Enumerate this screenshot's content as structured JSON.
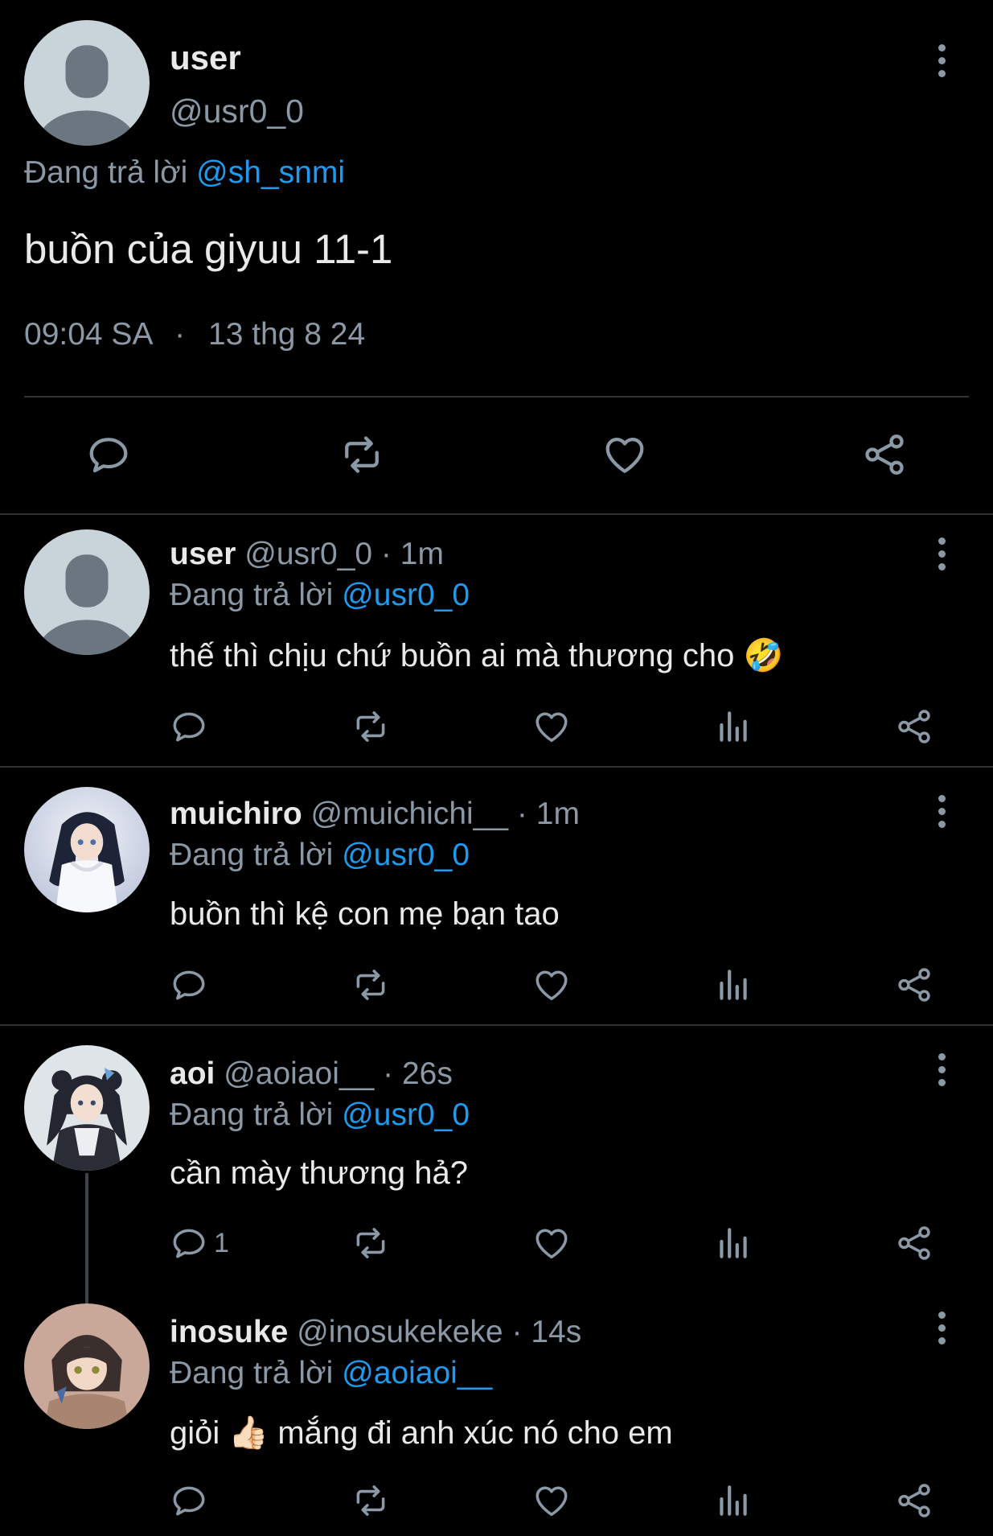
{
  "main_tweet": {
    "display_name": "user",
    "handle": "@usr0_0",
    "replying_prefix": "Đang trả lời",
    "replying_handle": "@sh_snmi",
    "text": "buồn của giyuu 11-1",
    "time": "09:04 SA",
    "separator": "·",
    "date": "13 thg 8 24"
  },
  "replies": [
    {
      "display_name": "user",
      "handle": "@usr0_0",
      "time_sep": "·",
      "time": "1m",
      "replying_prefix": "Đang trả lời",
      "replying_handle": "@usr0_0",
      "text": "thế thì chịu chứ buồn ai mà thương cho",
      "emoji": "🤣",
      "reply_count": ""
    },
    {
      "display_name": "muichiro",
      "handle": "@muichichi__",
      "time_sep": "·",
      "time": "1m",
      "replying_prefix": "Đang trả lời",
      "replying_handle": "@usr0_0",
      "text": "buồn thì kệ con mẹ bạn tao",
      "emoji": "",
      "reply_count": ""
    },
    {
      "display_name": "aoi",
      "handle": "@aoiaoi__",
      "time_sep": "·",
      "time": "26s",
      "replying_prefix": "Đang trả lời",
      "replying_handle": "@usr0_0",
      "text": "cần mày thương hả?",
      "emoji": "",
      "reply_count": "1"
    },
    {
      "display_name": "inosuke",
      "handle": "@inosukekeke",
      "time_sep": "·",
      "time": "14s",
      "replying_prefix": "Đang trả lời",
      "replying_handle": "@aoiaoi__",
      "text_before": "giỏi",
      "emoji": "👍🏻",
      "text_after": "mắng đi anh xúc nó cho em",
      "reply_count": ""
    }
  ],
  "colors": {
    "background": "#000000",
    "text": "#e7e9ea",
    "muted": "#8b98a5",
    "link": "#1d9bf0",
    "divider": "#2f3336"
  },
  "icons": {
    "reply": "reply-icon",
    "retweet": "retweet-icon",
    "like": "heart-icon",
    "views": "views-icon",
    "share": "share-icon",
    "more": "more-options-icon"
  }
}
